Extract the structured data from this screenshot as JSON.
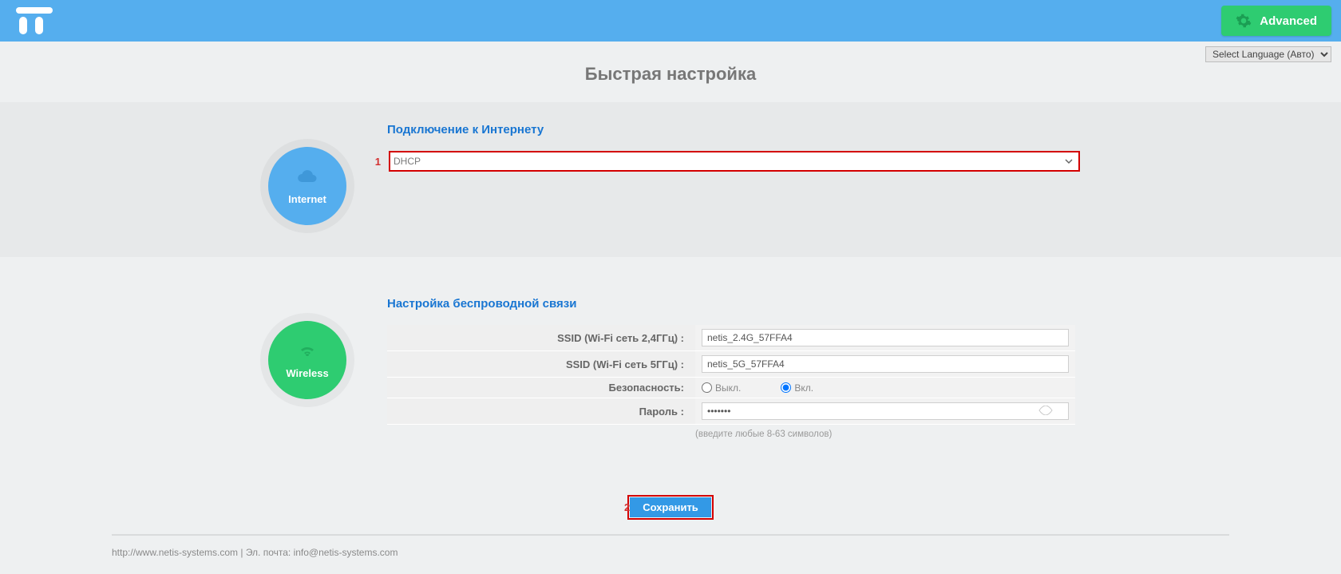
{
  "header": {
    "advanced_label": "Advanced"
  },
  "language": {
    "selected": "Select Language (Авто)"
  },
  "page_title": "Быстрая настройка",
  "internet": {
    "title": "Подключение к Интернету",
    "circle_label": "Internet",
    "annotation_number": "1",
    "wan_type_selected": "DHCP"
  },
  "wireless": {
    "title": "Настройка беспроводной связи",
    "circle_label": "Wireless",
    "labels": {
      "ssid24": "SSID (Wi-Fi сеть 2,4ГГц) :",
      "ssid5": "SSID (Wi-Fi сеть 5ГГц) :",
      "security": "Безопасность:",
      "password": "Пароль :"
    },
    "values": {
      "ssid24": "netis_2.4G_57FFA4",
      "ssid5": "netis_5G_57FFA4",
      "sec_off": "Выкл.",
      "sec_on": "Вкл.",
      "password": "1234567"
    },
    "hint": "(введите любые 8-63 символов)"
  },
  "save": {
    "annotation_number": "2",
    "label": "Сохранить"
  },
  "footer": {
    "text": "http://www.netis-systems.com | Эл. почта: info@netis-systems.com"
  }
}
